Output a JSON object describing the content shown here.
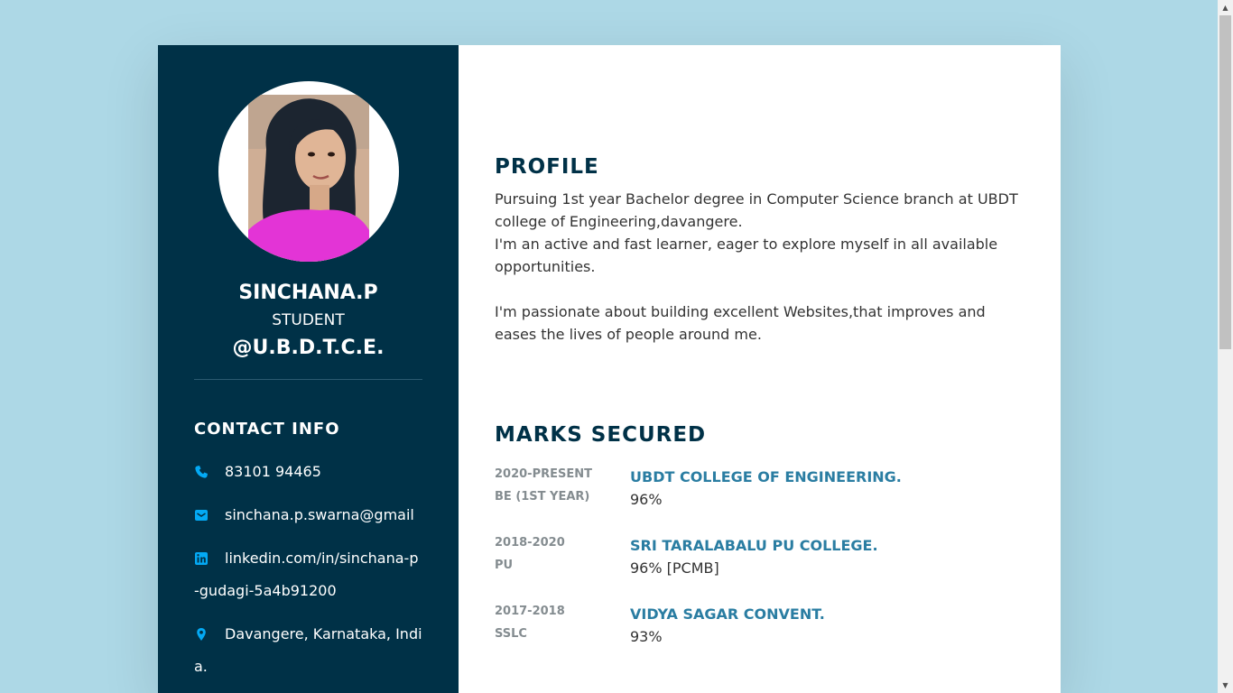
{
  "sidebar": {
    "name": "SINCHANA.P",
    "role": "STUDENT",
    "org": "@U.B.D.T.C.E.",
    "contact_title": "CONTACT INFO",
    "contacts": [
      {
        "icon": "phone-icon",
        "text": "83101 94465"
      },
      {
        "icon": "envelope-icon",
        "text": "sinchana.p.swarna@gmail"
      },
      {
        "icon": "linkedin-icon",
        "text": "linkedin.com/in/sinchana-p-gudagi-5a4b91200"
      },
      {
        "icon": "map-marker-icon",
        "text": "Davangere, Karnataka, India."
      }
    ],
    "accent_color": "#03a9f4",
    "background_color": "#003147"
  },
  "profile": {
    "title": "PROFILE",
    "para1_line1": "Pursuing 1st year Bachelor degree in Computer Science branch at UBDT college of Engineering,davangere.",
    "para1_line2": "I'm an active and fast learner, eager to explore myself in all available opportunities.",
    "para2": "I'm passionate about building excellent Websites,that improves and eases the lives of people around me."
  },
  "marks": {
    "title": "MARKS SECURED",
    "items": [
      {
        "years": "2020-PRESENT",
        "level": "BE (1ST YEAR)",
        "school": "UBDT COLLEGE OF ENGINEERING.",
        "score": "96%"
      },
      {
        "years": "2018-2020",
        "level": "PU",
        "school": "SRI TARALABALU PU COLLEGE.",
        "score": "96% [PCMB]"
      },
      {
        "years": "2017-2018",
        "level": "SSLC",
        "school": "VIDYA SAGAR CONVENT.",
        "score": "93%"
      }
    ]
  }
}
